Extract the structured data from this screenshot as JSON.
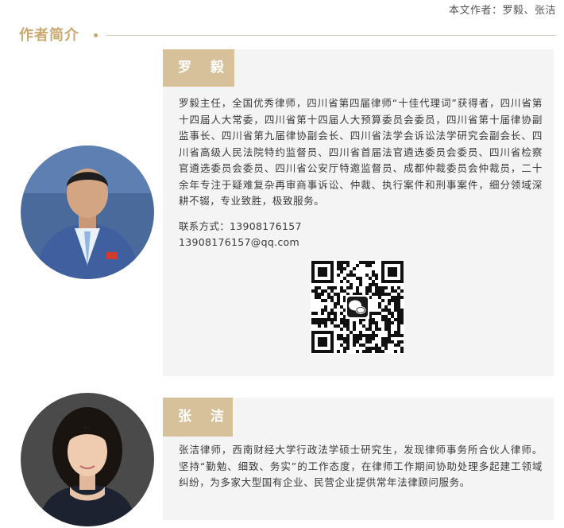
{
  "byline": "本文作者：罗毅、张洁",
  "section": {
    "title": "作者简介"
  },
  "authors": [
    {
      "name": "罗 毅",
      "bio": "罗毅主任，全国优秀律师，四川省第四届律师“十佳代理词”获得者，四川省第十四届人大常委，四川省第十四届人大预算委员会委员，四川省第十届律协副监事长、四川省第九届律协副会长、四川省法学会诉讼法学研究会副会长、四川省高级人民法院特约监督员、四川省首届法官遴选委员会委员、四川省检察官遴选委员会委员、四川省公安厅特邀监督员、成都仲裁委员会仲裁员，二十余年专注于疑难复杂再审商事诉讼、仲裁、执行案件和刑事案件，细分领域深耕不辍，专业致胜，极致服务。",
      "contact_phone": "联系方式：13908176157",
      "contact_email": "13908176157@qq.com",
      "qr_icon": "wechat-icon"
    },
    {
      "name": "张 洁",
      "bio": "张洁律师，西南财经大学行政法学硕士研究生，发现律师事务所合伙人律师。坚持“勤勉、细致、务实”的工作态度，在律师工作期间协助处理多起建工领域纠纷，为多家大型国有企业、民营企业提供常年法律顾问服务。"
    }
  ],
  "colors": {
    "accent": "#c9a970",
    "name_tag": "#d6c19a",
    "card_bg": "#f4f4f4",
    "rule": "#d8c9b6"
  }
}
